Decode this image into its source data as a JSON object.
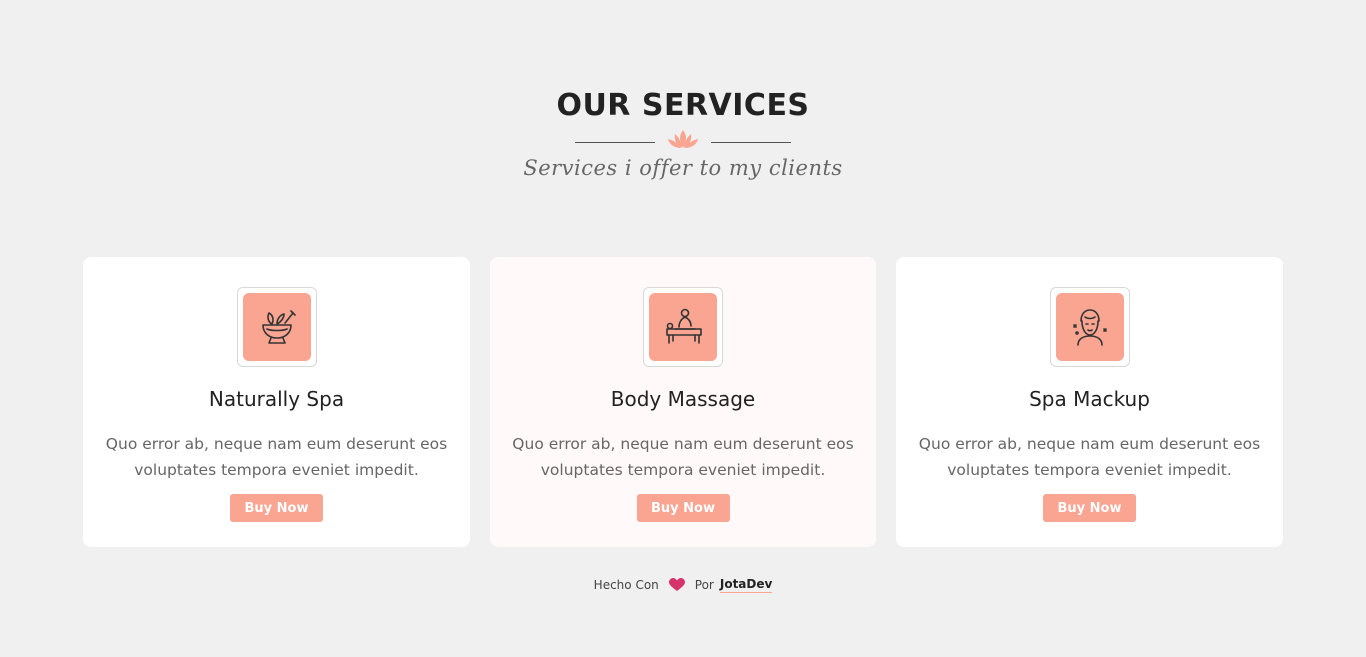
{
  "section": {
    "title": "OUR SERVICES",
    "subtitle": "Services i offer to my clients"
  },
  "colors": {
    "accent": "#f9a592",
    "heart": "#d6336c",
    "background": "#f0f0f0"
  },
  "services": [
    {
      "icon": "mortar-herbs-icon",
      "title": "Naturally Spa",
      "description": "Quo error ab, neque nam eum deserunt eos voluptates tempora eveniet impedit.",
      "button": "Buy Now"
    },
    {
      "icon": "massage-icon",
      "title": "Body Massage",
      "description": "Quo error ab, neque nam eum deserunt eos voluptates tempora eveniet impedit.",
      "button": "Buy Now"
    },
    {
      "icon": "face-mask-icon",
      "title": "Spa Mackup",
      "description": "Quo error ab, neque nam eum deserunt eos voluptates tempora eveniet impedit.",
      "button": "Buy Now"
    }
  ],
  "footer": {
    "made_with": "Hecho Con",
    "by": "Por",
    "author": "JotaDev"
  }
}
